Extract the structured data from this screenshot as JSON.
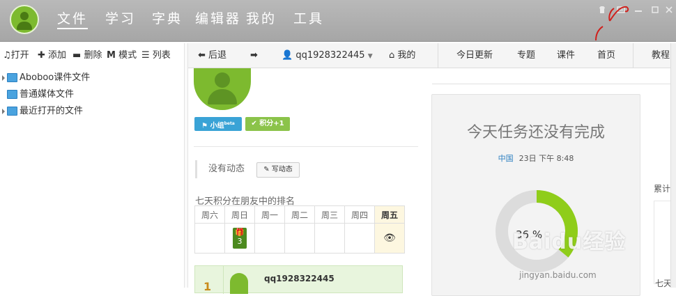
{
  "nav": {
    "items": [
      "文件",
      "学习",
      "字典",
      "编辑器",
      "我的",
      "工具"
    ],
    "active_index": 0
  },
  "window_controls": [
    "skin",
    "feedback",
    "minimize",
    "maximize",
    "close"
  ],
  "left_toolbar": {
    "open": "打开",
    "add": "添加",
    "delete": "删除",
    "mode": "模式",
    "list": "列表"
  },
  "tree": [
    {
      "label": "Aboboo课件文件",
      "expandable": true
    },
    {
      "label": "普通媒体文件",
      "expandable": false
    },
    {
      "label": "最近打开的文件",
      "expandable": true
    }
  ],
  "browser_toolbar": {
    "back": "后退",
    "username": "qq1928322445",
    "mine": "我的",
    "links": [
      "今日更新",
      "专题",
      "课件",
      "首页",
      "教程"
    ]
  },
  "badges": {
    "group": "小组",
    "group_sup": "beta",
    "points": "积分+1"
  },
  "feed": {
    "empty": "没有动态",
    "write": "写动态"
  },
  "ranking": {
    "title": "七天积分在朋友中的排名",
    "days": [
      "周六",
      "周日",
      "周一",
      "周二",
      "周三",
      "周四",
      "周五"
    ],
    "gift_count": "3",
    "today_index": 6,
    "first_row": {
      "rank": "1",
      "name": "qq1928322445"
    }
  },
  "tasks": {
    "title": "今天任务还没有完成",
    "location": "中国",
    "time": "23日 下午 8:48",
    "percent_label": "36 %",
    "percent": 36
  },
  "right_edge": {
    "label": "累计",
    "bottom_label": "七天"
  },
  "watermark": {
    "text": "Baidu经验",
    "url": "jingyan.baidu.com"
  },
  "colors": {
    "brand_green": "#7dba2f",
    "badge_blue": "#3aa3d6",
    "badge_green": "#8bc34a",
    "title_bar": "#ababab"
  }
}
